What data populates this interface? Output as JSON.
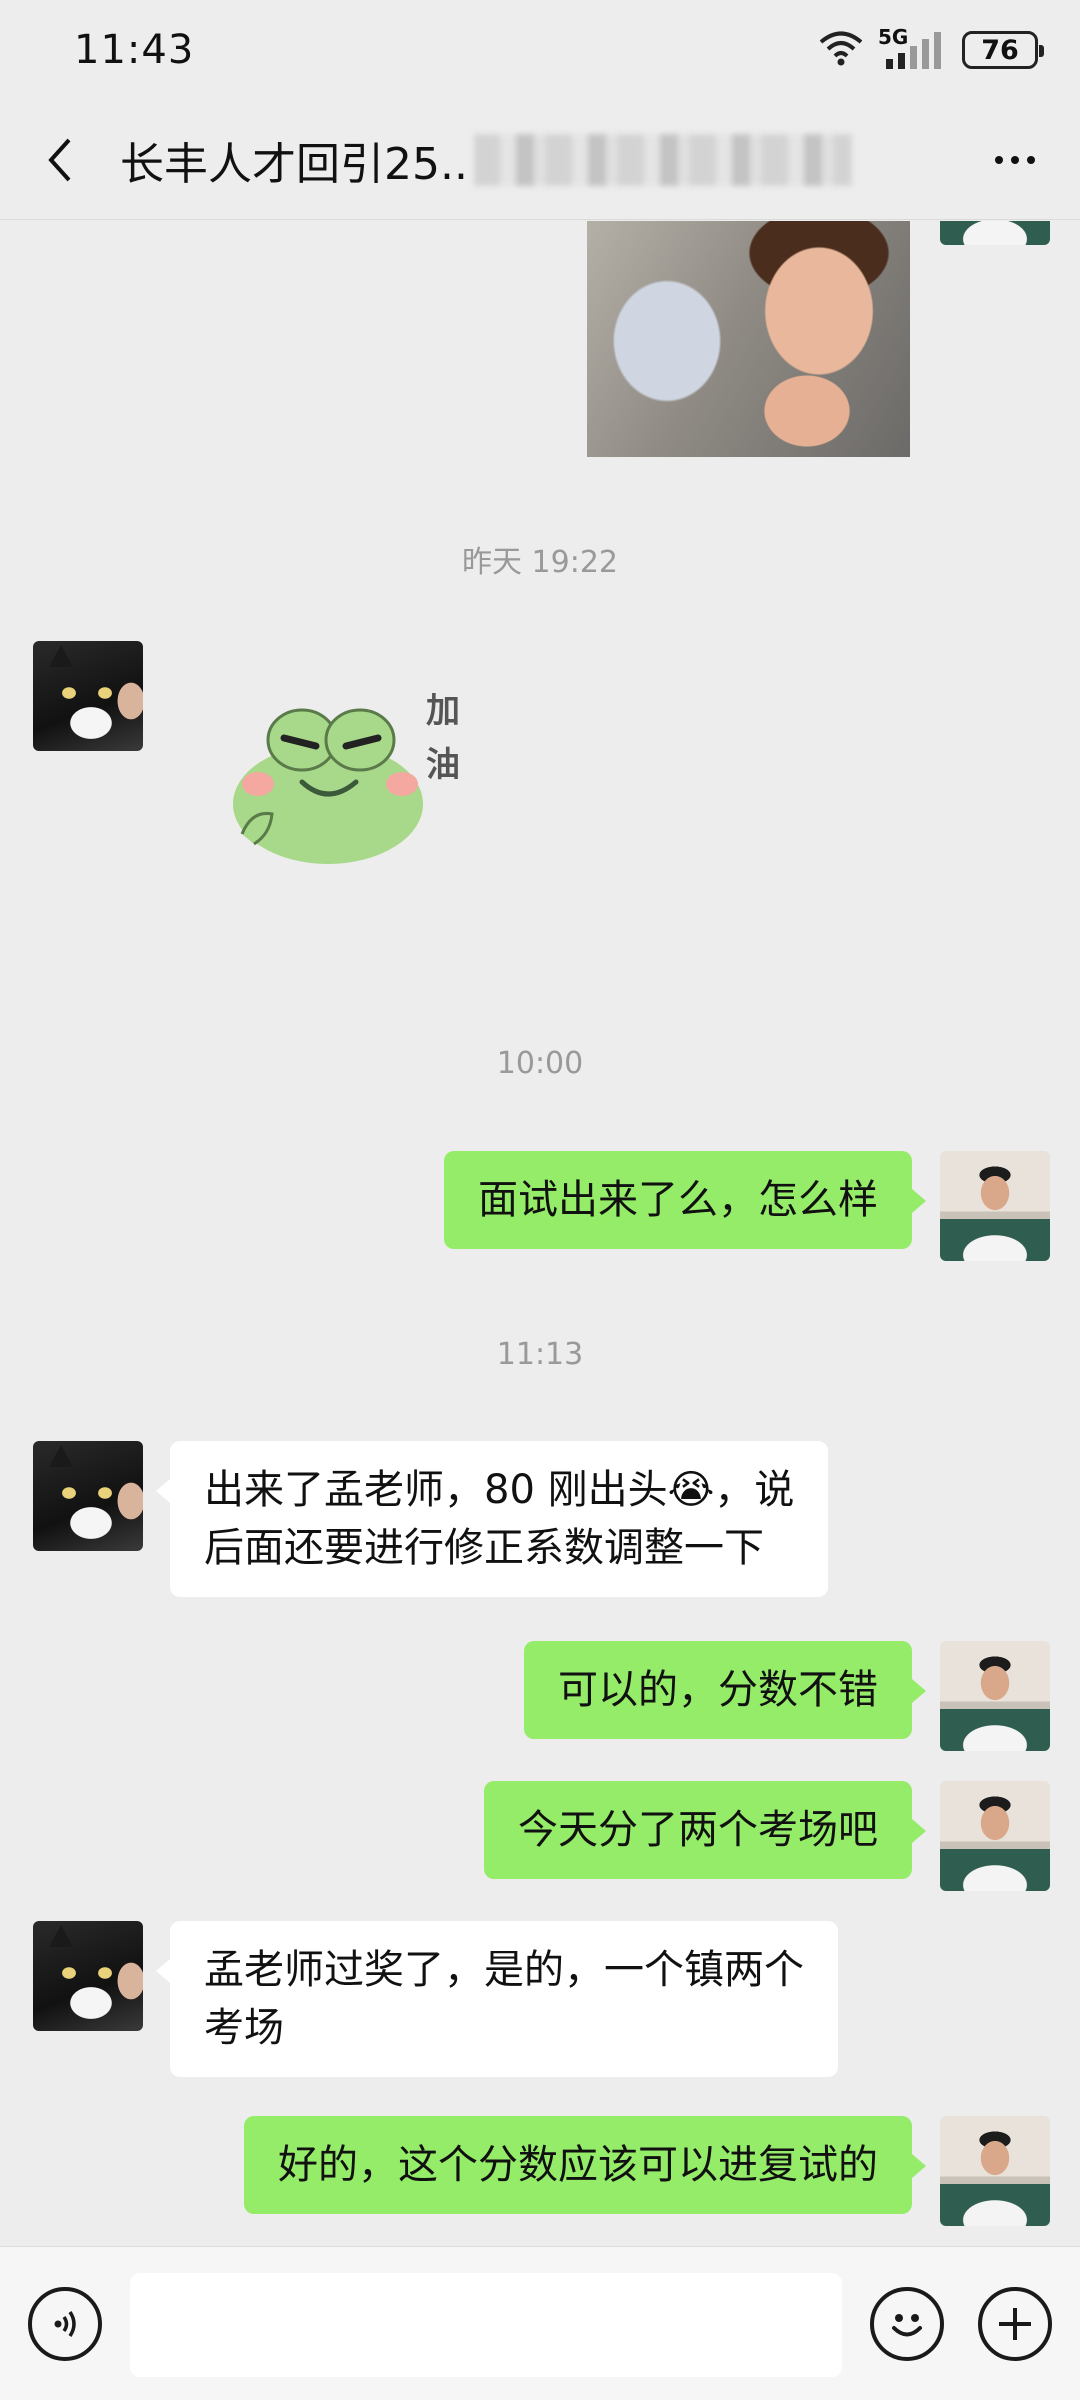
{
  "status_bar": {
    "time": "11:43",
    "network": "5G",
    "battery": "76"
  },
  "header": {
    "title": "长丰人才回引25..",
    "back_icon": "chevron-left-icon",
    "more_icon": "more-horizontal-icon"
  },
  "chat": {
    "timestamps": [
      "昨天 19:22",
      "10:00",
      "11:13"
    ],
    "sticker_text": "加\n油",
    "messages": [
      {
        "from": "me",
        "type": "image",
        "content": "photo of a child with headphones"
      },
      {
        "from": "other",
        "type": "sticker",
        "content": "frog sticker"
      },
      {
        "from": "me",
        "type": "text",
        "text": "面试出来了么，怎么样"
      },
      {
        "from": "other",
        "type": "text",
        "text": "出来了孟老师，80 刚出头😭，说\n后面还要进行修正系数调整一下"
      },
      {
        "from": "me",
        "type": "text",
        "text": "可以的，分数不错"
      },
      {
        "from": "me",
        "type": "text",
        "text": "今天分了两个考场吧"
      },
      {
        "from": "other",
        "type": "text",
        "text": "孟老师过奖了，是的，一个镇两个\n考场"
      },
      {
        "from": "me",
        "type": "text",
        "text": "好的，这个分数应该可以进复试的"
      }
    ]
  },
  "input_bar": {
    "voice_icon": "voice-icon",
    "emoji_icon": "emoji-icon",
    "plus_icon": "plus-icon"
  },
  "colors": {
    "background": "#ededed",
    "my_bubble": "#95ec69",
    "other_bubble": "#ffffff",
    "timestamp": "#999999"
  }
}
